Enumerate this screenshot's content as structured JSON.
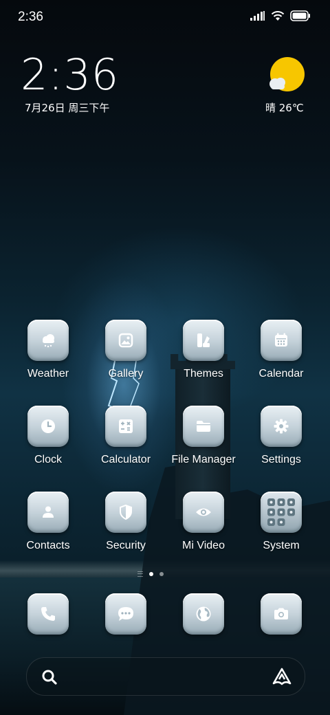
{
  "status_bar": {
    "time": "2:36",
    "icons": [
      "signal-icon",
      "wifi-icon",
      "battery-icon"
    ]
  },
  "clock_widget": {
    "time": "2:36",
    "date": "7月26日 周三下午"
  },
  "weather_widget": {
    "icon": "sun-cloud-icon",
    "text": "晴 26℃"
  },
  "apps": [
    {
      "label": "Weather",
      "icon": "weather-cloud-icon"
    },
    {
      "label": "Gallery",
      "icon": "image-icon"
    },
    {
      "label": "Themes",
      "icon": "themes-icon"
    },
    {
      "label": "Calendar",
      "icon": "calendar-icon"
    },
    {
      "label": "Clock",
      "icon": "clock-icon"
    },
    {
      "label": "Calculator",
      "icon": "calculator-icon"
    },
    {
      "label": "File Manager",
      "icon": "folder-icon"
    },
    {
      "label": "Settings",
      "icon": "gear-icon"
    },
    {
      "label": "Contacts",
      "icon": "person-icon"
    },
    {
      "label": "Security",
      "icon": "shield-icon"
    },
    {
      "label": "Mi Video",
      "icon": "eye-icon"
    },
    {
      "label": "System",
      "icon": "folder-grid-icon"
    }
  ],
  "page_indicator": {
    "pages": 2,
    "active": 1
  },
  "dock": [
    {
      "icon": "phone-icon"
    },
    {
      "icon": "message-icon"
    },
    {
      "icon": "browser-globe-icon"
    },
    {
      "icon": "camera-icon"
    }
  ],
  "search_bar": {
    "left_icon": "search-icon",
    "right_icon": "assistant-icon"
  },
  "colors": {
    "tile_top": "#e9f0f4",
    "tile_bottom": "#98abb6",
    "glyph": "#ffffff",
    "sun": "#f7c600"
  }
}
